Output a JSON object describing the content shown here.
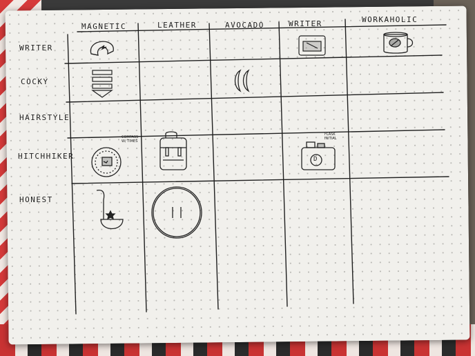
{
  "columns": [
    "MAGNETIC",
    "LEATHER",
    "AVOCADO",
    "WRITER",
    "WORKAHOLIC"
  ],
  "rows": [
    "WRITER",
    "COCKY",
    "HAIRSTYLE",
    "HITCHHIKER",
    "HONEST"
  ],
  "notes": {
    "compass": "COMPASS\nW/ TIMES",
    "flask": "FLASK\nINITIAL"
  },
  "flask_initial": "D"
}
